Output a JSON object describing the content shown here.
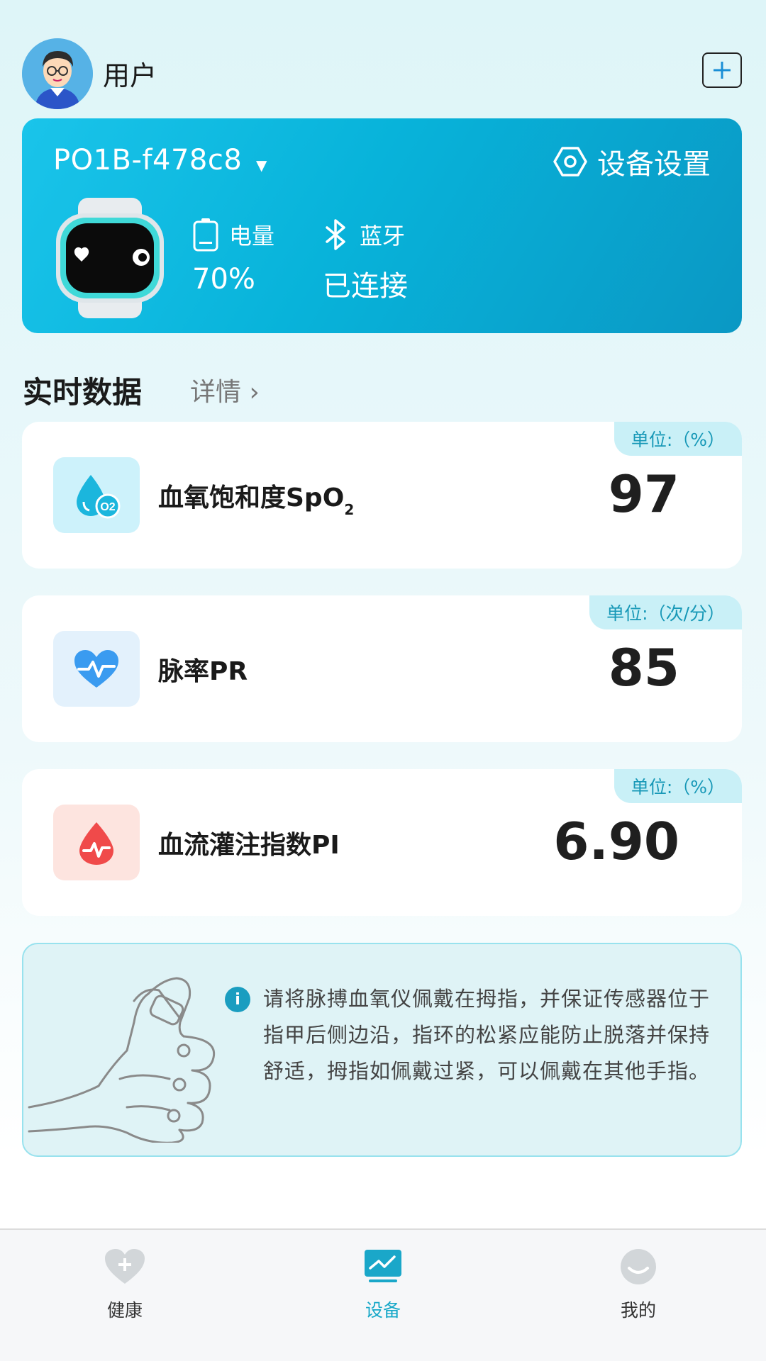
{
  "header": {
    "user_name": "用户"
  },
  "device": {
    "name": "PO1B-f478c8",
    "settings_label": "设备设置",
    "battery": {
      "label": "电量",
      "value": "70%"
    },
    "bluetooth": {
      "label": "蓝牙",
      "value": "已连接"
    }
  },
  "section": {
    "title": "实时数据",
    "details": "详情"
  },
  "metrics": [
    {
      "label": "血氧饱和度SpO",
      "subscript": "2",
      "value": "97",
      "unit": "单位:（%）"
    },
    {
      "label": "脉率PR",
      "value": "85",
      "unit": "单位:（次/分）"
    },
    {
      "label": "血流灌注指数PI",
      "value": "6.90",
      "unit": "单位:（%）"
    }
  ],
  "tip": {
    "text": "请将脉搏血氧仪佩戴在拇指，并保证传感器位于指甲后侧边沿，指环的松紧应能防止脱落并保持舒适，拇指如佩戴过紧，可以佩戴在其他手指。"
  },
  "nav": [
    {
      "label": "健康",
      "icon": "heart-plus-icon"
    },
    {
      "label": "设备",
      "icon": "monitor-icon",
      "active": true
    },
    {
      "label": "我的",
      "icon": "smile-icon"
    }
  ],
  "colors": {
    "accent": "#17a8c8",
    "card_gradient_start": "#1ac4ea",
    "card_gradient_end": "#0a98c4"
  }
}
